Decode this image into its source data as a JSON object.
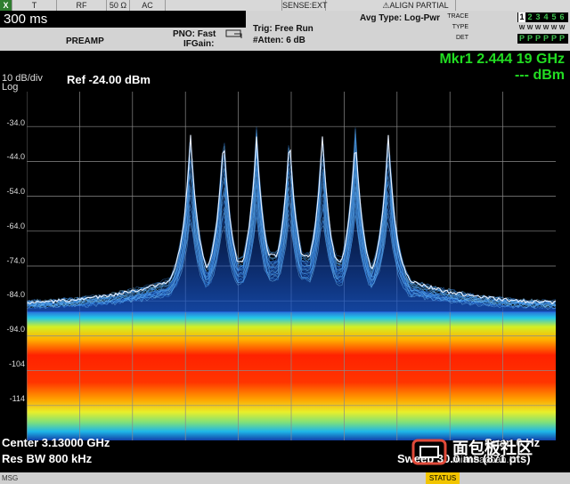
{
  "topstrip": {
    "x_label": "X",
    "cells": [
      "T",
      "RF",
      "50 Ω",
      "AC",
      "SENSE:EXT",
      "ALIGN PARTIAL"
    ]
  },
  "header": {
    "sweep_time": "300 ms",
    "preamp": "PREAMP",
    "pno_fast": "PNO: Fast",
    "if_gain": "IFGain:",
    "trig": "Trig: Free Run",
    "atten": "#Atten: 6 dB",
    "avg_type": "Avg Type: Log-Pwr",
    "trace_label": "TRACE",
    "type_label": "TYPE",
    "det_label": "DET",
    "trace_digits": [
      "1",
      "2",
      "3",
      "4",
      "5",
      "6"
    ],
    "type_chars": [
      "W",
      "W",
      "W",
      "W",
      "W",
      "W"
    ],
    "det_chars": [
      "P",
      "P",
      "P",
      "P",
      "P",
      "P"
    ]
  },
  "screen": {
    "scale_div": "10 dB/div",
    "log": "Log",
    "ref": "Ref -24.00 dBm",
    "marker_line1": "Mkr1 2.444 19 GHz",
    "marker_line2": "--- dBm",
    "marker_number": "1",
    "y_ticks": [
      "-34.0",
      "-44.0",
      "-54.0",
      "-64.0",
      "-74.0",
      "-84.0",
      "-94.0",
      "-104",
      "-114"
    ],
    "center": "Center 3.13000 GHz",
    "res_bw": "Res BW 800 kHz",
    "span": "Span 0 Hz",
    "sweep": "Sweep 30.0 ms (871 pts)"
  },
  "colors": {
    "marker": "#22dd22",
    "status": "#f2c500",
    "grid": "#8a8a8a",
    "noise_hot": "#ff2200",
    "trace": "#4aa8ff"
  },
  "bottombar": {
    "msg": "MSG",
    "status": "STATUS"
  },
  "watermark": {
    "cn": "面包板社区",
    "en": "mianbaoban.cn"
  }
}
